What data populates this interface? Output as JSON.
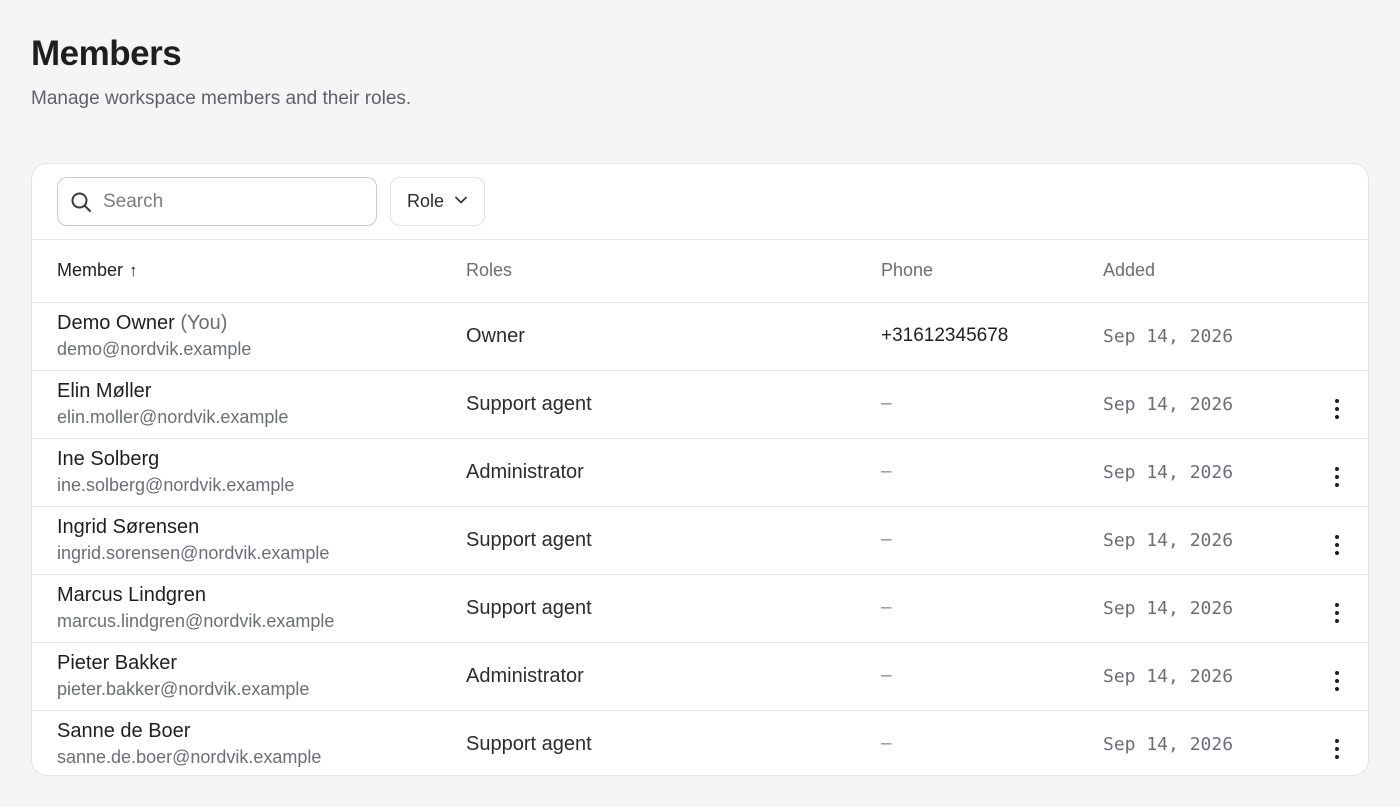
{
  "header": {
    "title": "Members",
    "subtitle": "Manage workspace members and their roles."
  },
  "toolbar": {
    "search_placeholder": "Search",
    "role_filter_label": "Role"
  },
  "columns": {
    "member": "Member",
    "member_sort_indicator": "↑",
    "roles": "Roles",
    "phone": "Phone",
    "added": "Added"
  },
  "members": [
    {
      "name": "Demo Owner",
      "you": "(You)",
      "email": "demo@nordvik.example",
      "role": "Owner",
      "phone": "+31612345678",
      "added": "Sep 14, 2026",
      "has_actions": false
    },
    {
      "name": "Elin Møller",
      "you": "",
      "email": "elin.moller@nordvik.example",
      "role": "Support agent",
      "phone": "–",
      "added": "Sep 14, 2026",
      "has_actions": true
    },
    {
      "name": "Ine Solberg",
      "you": "",
      "email": "ine.solberg@nordvik.example",
      "role": "Administrator",
      "phone": "–",
      "added": "Sep 14, 2026",
      "has_actions": true
    },
    {
      "name": "Ingrid Sørensen",
      "you": "",
      "email": "ingrid.sorensen@nordvik.example",
      "role": "Support agent",
      "phone": "–",
      "added": "Sep 14, 2026",
      "has_actions": true
    },
    {
      "name": "Marcus Lindgren",
      "you": "",
      "email": "marcus.lindgren@nordvik.example",
      "role": "Support agent",
      "phone": "–",
      "added": "Sep 14, 2026",
      "has_actions": true
    },
    {
      "name": "Pieter Bakker",
      "you": "",
      "email": "pieter.bakker@nordvik.example",
      "role": "Administrator",
      "phone": "–",
      "added": "Sep 14, 2026",
      "has_actions": true
    },
    {
      "name": "Sanne de Boer",
      "you": "",
      "email": "sanne.de.boer@nordvik.example",
      "role": "Support agent",
      "phone": "–",
      "added": "Sep 14, 2026",
      "has_actions": true
    }
  ],
  "icons": {
    "search": "search-icon",
    "role_dropdown": "chevron-down-icon",
    "row_actions": "more-vertical-icon"
  }
}
